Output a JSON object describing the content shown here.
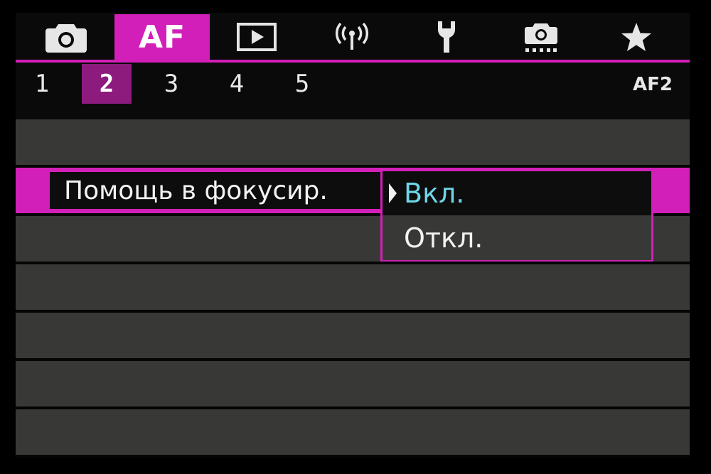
{
  "tabs": [
    {
      "name": "shooting",
      "icon": "camera-icon",
      "label": ""
    },
    {
      "name": "af",
      "icon": "",
      "label": "AF"
    },
    {
      "name": "playback",
      "icon": "play-icon",
      "label": ""
    },
    {
      "name": "wireless",
      "icon": "wireless-icon",
      "label": ""
    },
    {
      "name": "setup",
      "icon": "wrench-icon",
      "label": ""
    },
    {
      "name": "custom",
      "icon": "custom-functions-icon",
      "label": ""
    },
    {
      "name": "my-menu",
      "icon": "star-icon",
      "label": ""
    }
  ],
  "active_tab": "AF",
  "subtabs": [
    "1",
    "2",
    "3",
    "4",
    "5"
  ],
  "active_subtab": "2",
  "page_code": "AF2",
  "menu": {
    "selected_item": "Помощь в фокусир."
  },
  "popup": {
    "options": [
      "Вкл.",
      "Откл."
    ],
    "current": "Вкл."
  },
  "colors": {
    "accent": "#d31fb9",
    "subtab_active": "#8c1b7d",
    "row_bg": "#383937",
    "highlight_text": "#6fd6e8"
  }
}
